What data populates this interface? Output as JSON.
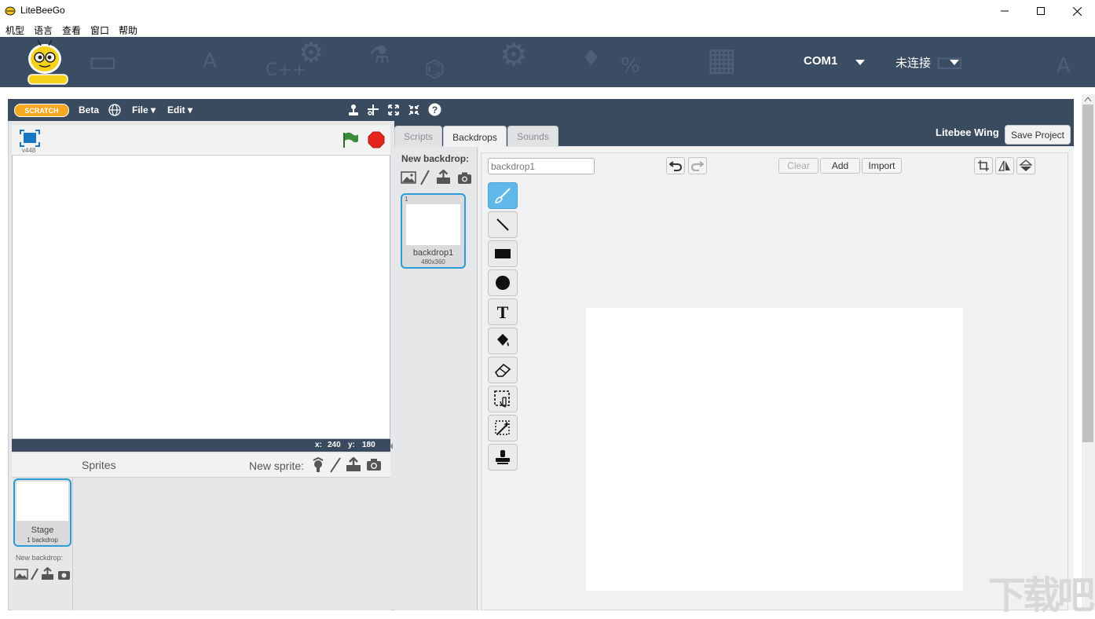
{
  "window": {
    "title": "LiteBeeGo",
    "minimize": "—",
    "maximize": "☐",
    "close": "✕"
  },
  "menubar": [
    "机型",
    "语言",
    "查看",
    "窗口",
    "帮助"
  ],
  "banner": {
    "port": "COM1",
    "connection": "未连接"
  },
  "scratch_toolbar": {
    "logo": "SCRATCH",
    "beta": "Beta",
    "file": "File ▾",
    "edit": "Edit ▾"
  },
  "stage": {
    "version": "v448",
    "x_label": "x:",
    "x_value": "240",
    "y_label": "y:",
    "y_value": "180"
  },
  "sprites": {
    "header": "Sprites",
    "new_sprite": "New sprite:",
    "stage_label": "Stage",
    "stage_sub": "1 backdrop",
    "new_backdrop": "New backdrop:"
  },
  "tabs": {
    "scripts": "Scripts",
    "backdrops": "Backdrops",
    "sounds": "Sounds",
    "project_name": "Litebee Wing",
    "save": "Save Project"
  },
  "costumes": {
    "new_backdrop": "New backdrop:",
    "thumb_number": "1",
    "thumb_name": "backdrop1",
    "thumb_size": "480x360"
  },
  "paint": {
    "name_value": "backdrop1",
    "clear": "Clear",
    "add": "Add",
    "import": "Import",
    "tools": [
      "brush-icon",
      "line-icon",
      "rectangle-icon",
      "ellipse-icon",
      "text-icon",
      "fill-icon",
      "eraser-icon",
      "select-icon",
      "magic-wand-icon",
      "stamp-icon"
    ]
  },
  "colors": {
    "banner": "#3b4d63",
    "scratch_bar": "#3a4b60",
    "accent": "#4aa3d4"
  }
}
